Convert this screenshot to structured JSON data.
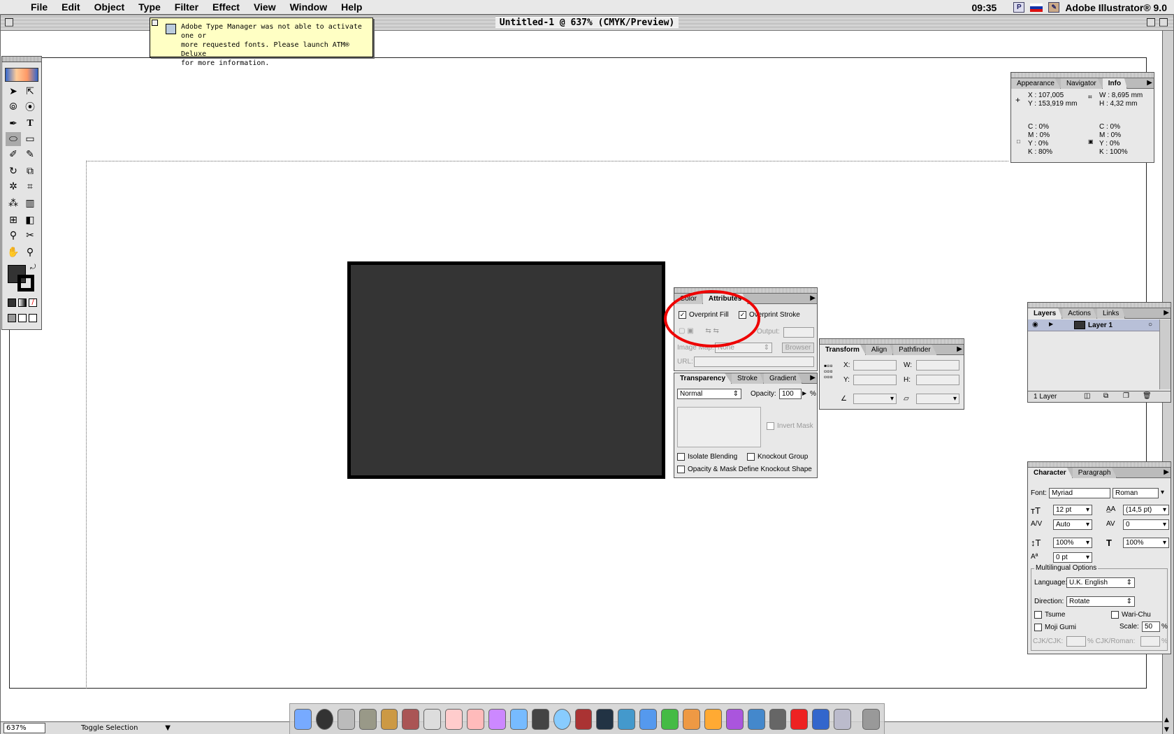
{
  "menubar": {
    "items": [
      "File",
      "Edit",
      "Object",
      "Type",
      "Filter",
      "Effect",
      "View",
      "Window",
      "Help"
    ],
    "clock": "09:35",
    "app": "Adobe Illustrator® 9.0"
  },
  "document": {
    "title": "Untitled-1 @ 637% (CMYK/Preview)",
    "zoom": "637%",
    "status": "Toggle Selection"
  },
  "alert": {
    "line1": "Adobe Type Manager was not able to activate one or",
    "line2": "more requested fonts.  Please launch ATM® Deluxe",
    "line3": "for more information."
  },
  "info_palette": {
    "tabs": [
      "Appearance",
      "Navigator",
      "Info"
    ],
    "x": "X : 107,005",
    "y": "Y : 153,919 mm",
    "w": "W : 8,695 mm",
    "h": "H : 4,32 mm",
    "fill": [
      "C : 0%",
      "M : 0%",
      "Y : 0%",
      "K : 80%"
    ],
    "stroke": [
      "C : 0%",
      "M : 0%",
      "Y : 0%",
      "K : 100%"
    ]
  },
  "attributes_palette": {
    "tabs": [
      "Color",
      "Attributes"
    ],
    "overprint_fill": "Overprint Fill",
    "overprint_stroke": "Overprint Stroke",
    "output": "Output:",
    "image_map_label": "Image Map:",
    "image_map_value": "None",
    "browser": "Browser",
    "url": "URL:"
  },
  "transparency_palette": {
    "tabs": [
      "Transparency",
      "Stroke",
      "Gradient"
    ],
    "mode": "Normal",
    "opacity_label": "Opacity:",
    "opacity_value": "100",
    "percent": "%",
    "invert_mask": "Invert Mask",
    "isolate": "Isolate Blending",
    "knockout": "Knockout Group",
    "opacity_mask": "Opacity & Mask Define Knockout Shape"
  },
  "transform_palette": {
    "tabs": [
      "Transform",
      "Align",
      "Pathfinder"
    ],
    "x": "X:",
    "y": "Y:",
    "w": "W:",
    "h": "H:"
  },
  "layers_palette": {
    "tabs": [
      "Layers",
      "Actions",
      "Links"
    ],
    "layer": "Layer 1",
    "count": "1 Layer"
  },
  "character_palette": {
    "tabs": [
      "Character",
      "Paragraph"
    ],
    "font_label": "Font:",
    "font": "Myriad",
    "style": "Roman",
    "size": "12 pt",
    "leading": "(14,5 pt)",
    "kerning": "Auto",
    "tracking": "0",
    "vscale": "100%",
    "hscale": "100%",
    "baseline": "0 pt",
    "multi": "Multilingual Options",
    "language_label": "Language:",
    "language": "U.K. English",
    "direction_label": "Direction:",
    "direction": "Rotate",
    "tsume": "Tsume",
    "warichu": "Wari-Chu",
    "mojigumi": "Moji Gumi",
    "scale_label": "Scale:",
    "scale": "50",
    "pct": "%",
    "cjkcjk": "CJK/CJK:",
    "cjkroman": "% CJK/Roman:",
    "pct2": "%"
  },
  "colors": {
    "accent_red": "#e00000",
    "rect_fill": "#343434"
  }
}
